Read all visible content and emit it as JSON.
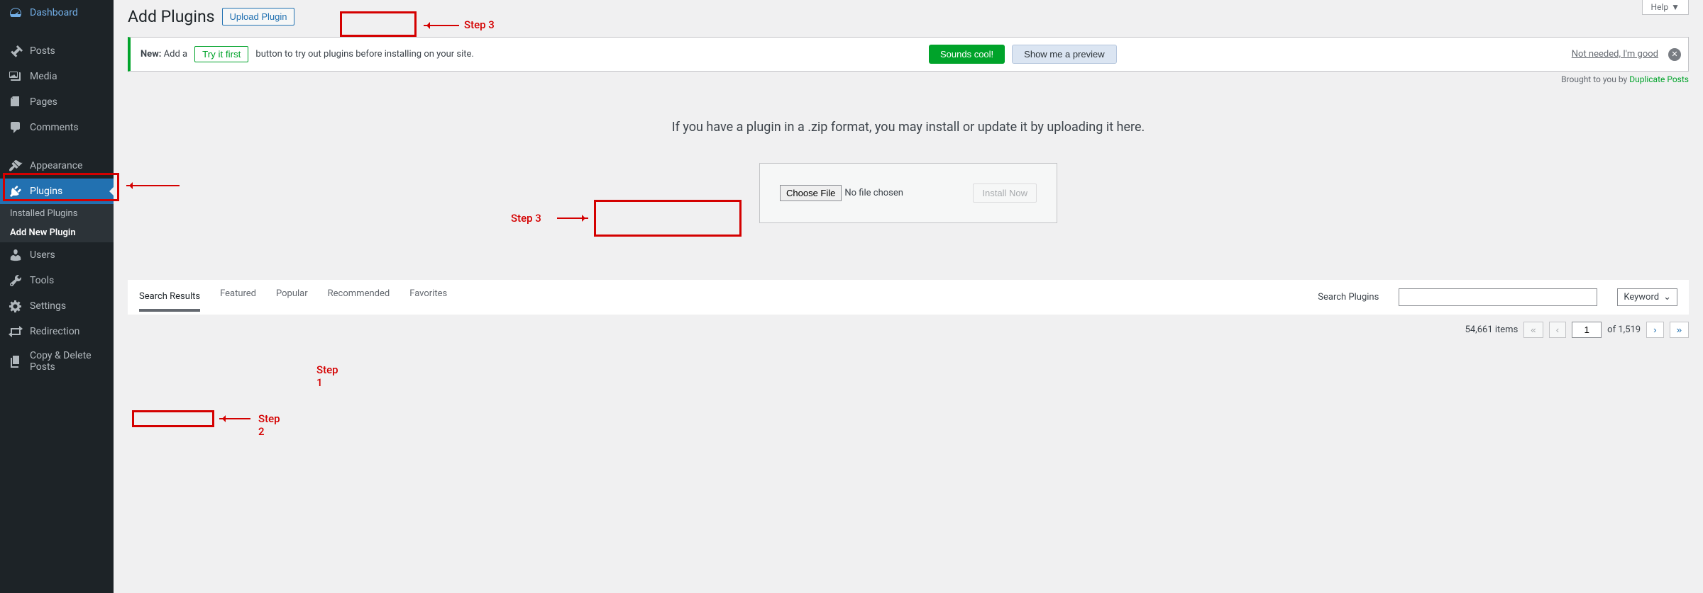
{
  "sidebar": {
    "items": [
      {
        "label": "Dashboard"
      },
      {
        "label": "Posts"
      },
      {
        "label": "Media"
      },
      {
        "label": "Pages"
      },
      {
        "label": "Comments"
      },
      {
        "label": "Appearance"
      },
      {
        "label": "Plugins"
      },
      {
        "label": "Users"
      },
      {
        "label": "Tools"
      },
      {
        "label": "Settings"
      },
      {
        "label": "Redirection"
      },
      {
        "label": "Copy & Delete Posts"
      }
    ],
    "submenu": [
      {
        "label": "Installed Plugins"
      },
      {
        "label": "Add New Plugin"
      }
    ]
  },
  "header": {
    "title": "Add Plugins",
    "upload_btn": "Upload Plugin",
    "help": "Help"
  },
  "notice": {
    "new_label": "New:",
    "add_a": "Add a",
    "try_btn": "Try it first",
    "tail": "button to try out plugins before installing on your site.",
    "sounds": "Sounds cool!",
    "preview": "Show me a preview",
    "not_needed": "Not needed, I'm good"
  },
  "brought": {
    "prefix": "Brought to you by ",
    "link": "Duplicate Posts"
  },
  "upload": {
    "heading": "If you have a plugin in a .zip format, you may install or update it by uploading it here.",
    "choose": "Choose File",
    "no_file": "No file chosen",
    "install": "Install Now"
  },
  "filters": {
    "tabs": [
      "Search Results",
      "Featured",
      "Popular",
      "Recommended",
      "Favorites"
    ],
    "search_label": "Search Plugins",
    "keyword": "Keyword"
  },
  "pagination": {
    "items": "54,661 items",
    "current": "1",
    "of": "of 1,519"
  },
  "annotations": {
    "step1": "Step 1",
    "step2": "Step 2",
    "step3": "Step 3"
  }
}
